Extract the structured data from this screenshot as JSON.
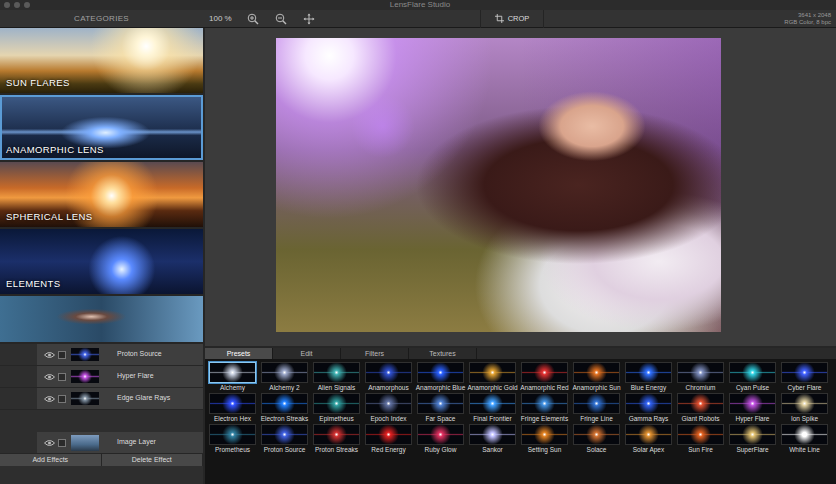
{
  "window": {
    "title": "LensFlare Studio"
  },
  "toolbar": {
    "categories_header": "CATEGORIES",
    "zoom": "100 %",
    "crop": "CROP",
    "image_size": "3641 x 2048",
    "color_mode": "RGB Color, 8 bpc"
  },
  "categories": [
    {
      "label": "SUN FLARES",
      "selected": false
    },
    {
      "label": "ANAMORPHIC LENS",
      "selected": true
    },
    {
      "label": "SPHERICAL LENS",
      "selected": false
    },
    {
      "label": "ELEMENTS",
      "selected": false
    },
    {
      "selected": false
    }
  ],
  "layers": [
    {
      "name": "Proton Source",
      "visible": true,
      "color": "#4060e0"
    },
    {
      "name": "Hyper Flare",
      "visible": true,
      "color": "#c050e0"
    },
    {
      "name": "Edge Glare Rays",
      "visible": true,
      "color": "#8090a0"
    }
  ],
  "image_layer": {
    "name": "Image Layer",
    "visible": true
  },
  "buttons": [
    "Add Effects",
    "Delete Effect"
  ],
  "tabs": [
    {
      "label": "Presets",
      "selected": true
    },
    {
      "label": "Edit",
      "selected": false
    },
    {
      "label": "Filters",
      "selected": false
    },
    {
      "label": "Textures",
      "selected": false
    }
  ],
  "presets": [
    {
      "name": "Alchemy",
      "selected": true,
      "color": "#c8d0e0"
    },
    {
      "name": "Alchemy 2",
      "selected": false,
      "color": "#9aa6c8"
    },
    {
      "name": "Alien Signals",
      "selected": false,
      "color": "#3fb0b0"
    },
    {
      "name": "Anamorphous",
      "selected": false,
      "color": "#3050d0"
    },
    {
      "name": "Anamorphic Blue",
      "selected": false,
      "color": "#2a60ff"
    },
    {
      "name": "Anamorphic Gold",
      "selected": false,
      "color": "#e0a030"
    },
    {
      "name": "Anamorphic Red",
      "selected": false,
      "color": "#e03030"
    },
    {
      "name": "Anamorphic Sun",
      "selected": false,
      "color": "#e07020"
    },
    {
      "name": "Blue Energy",
      "selected": false,
      "color": "#3070ff"
    },
    {
      "name": "Chromium",
      "selected": false,
      "color": "#8090c0"
    },
    {
      "name": "Cyan Pulse",
      "selected": false,
      "color": "#30d0e0"
    },
    {
      "name": "Cyber Flare",
      "selected": false,
      "color": "#4060ff"
    },
    {
      "name": "Electron Hex",
      "selected": false,
      "color": "#3050ff"
    },
    {
      "name": "Electron Streaks",
      "selected": false,
      "color": "#2080ff"
    },
    {
      "name": "Epimetheus",
      "selected": false,
      "color": "#30a0a0"
    },
    {
      "name": "Epoch Index",
      "selected": false,
      "color": "#6070a0"
    },
    {
      "name": "Far Space",
      "selected": false,
      "color": "#5080d0"
    },
    {
      "name": "Final Frontier",
      "selected": false,
      "color": "#40a0ff"
    },
    {
      "name": "Fringe Elements",
      "selected": false,
      "color": "#4090e0"
    },
    {
      "name": "Fringe Line",
      "selected": false,
      "color": "#3070d0"
    },
    {
      "name": "Gamma Rays",
      "selected": false,
      "color": "#3060f0"
    },
    {
      "name": "Giant Robots",
      "selected": false,
      "color": "#e05030"
    },
    {
      "name": "Hyper Flare",
      "selected": false,
      "color": "#c050e0"
    },
    {
      "name": "Ion Spike",
      "selected": false,
      "color": "#e0d0a0"
    },
    {
      "name": "Prometheus",
      "selected": false,
      "color": "#3080a0"
    },
    {
      "name": "Proton Source",
      "selected": false,
      "color": "#4060e0"
    },
    {
      "name": "Proton Streaks",
      "selected": false,
      "color": "#d03030"
    },
    {
      "name": "Red Energy",
      "selected": false,
      "color": "#e02020"
    },
    {
      "name": "Ruby Glow",
      "selected": false,
      "color": "#e03060"
    },
    {
      "name": "Sankor",
      "selected": false,
      "color": "#c0c0ff"
    },
    {
      "name": "Setting Sun",
      "selected": false,
      "color": "#e08020"
    },
    {
      "name": "Solace",
      "selected": false,
      "color": "#d07030"
    },
    {
      "name": "Solar Apex",
      "selected": false,
      "color": "#e09030"
    },
    {
      "name": "Sun Fire",
      "selected": false,
      "color": "#e06020"
    },
    {
      "name": "SuperFlare",
      "selected": false,
      "color": "#e0c070"
    },
    {
      "name": "White Line",
      "selected": false,
      "color": "#ffffff"
    }
  ]
}
